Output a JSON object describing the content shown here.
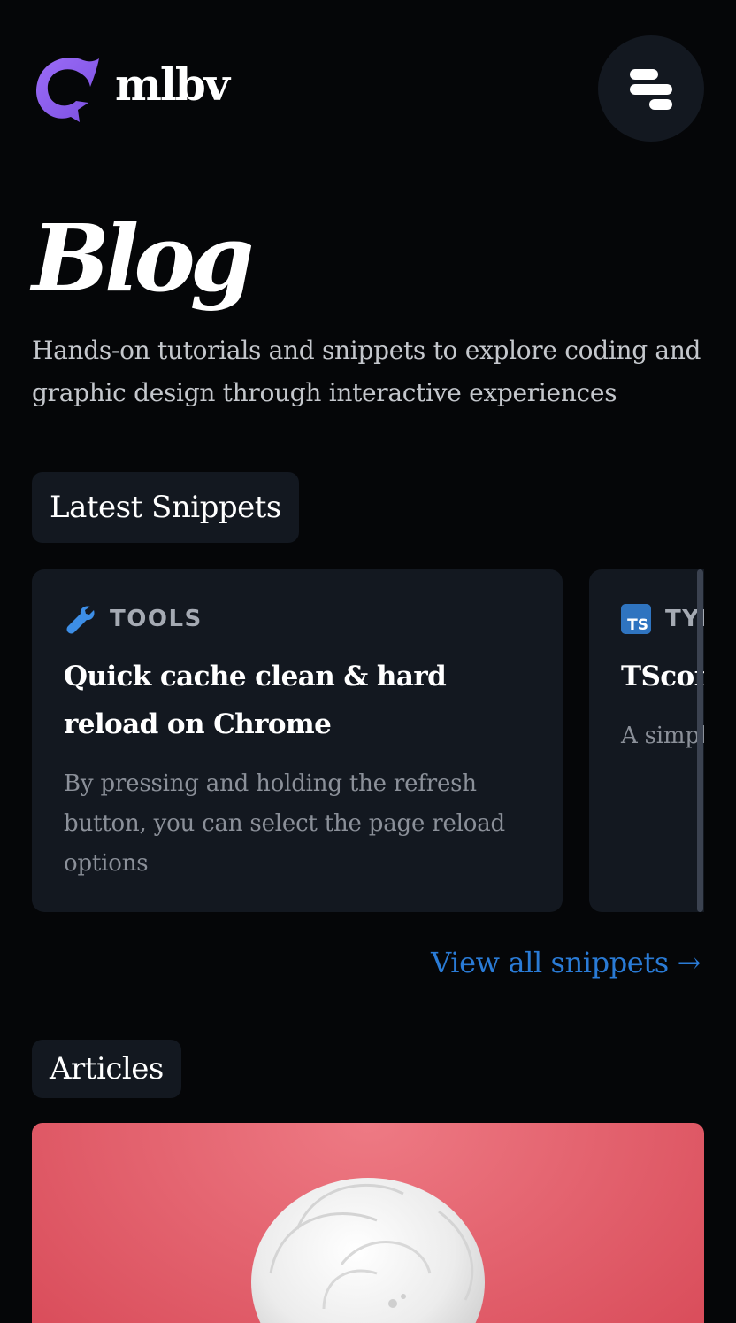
{
  "header": {
    "logo_text": "mlbv",
    "menu_label": "Menu"
  },
  "hero": {
    "title": "Blog",
    "subtitle": "Hands-on tutorials and snippets to explore coding and graphic design through interactive experiences"
  },
  "snippets": {
    "section_label": "Latest Snippets",
    "cards": [
      {
        "category": "TOOLS",
        "icon": "wrench-icon",
        "title": "Quick cache clean & hard reload on Chrome",
        "description": "By pressing and holding the refresh button, you can select the page reload options"
      },
      {
        "category": "TYPESCRIPT",
        "icon": "typescript-icon",
        "icon_text": "TS",
        "title": "TSconfig",
        "description": "A simple TSconfig to kickstart"
      }
    ],
    "view_all_label": "View all snippets →"
  },
  "articles": {
    "section_label": "Articles"
  },
  "colors": {
    "background": "#050608",
    "surface": "#131820",
    "accent_link": "#2a7bd6",
    "logo_purple": "#8b5cf6",
    "hero_red": "#e46470"
  }
}
